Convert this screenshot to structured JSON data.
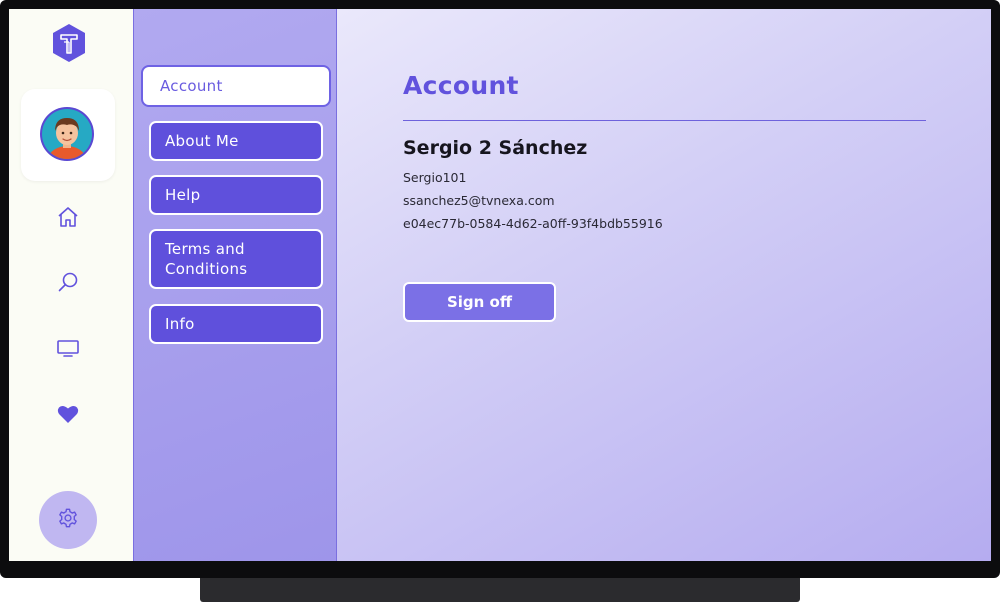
{
  "menu": {
    "items": [
      {
        "label": "Account",
        "active": true
      },
      {
        "label": "About Me"
      },
      {
        "label": "Help"
      },
      {
        "label": "Terms and Conditions"
      },
      {
        "label": "Info"
      }
    ]
  },
  "account": {
    "title": "Account",
    "name": "Sergio 2 Sánchez",
    "username": "Sergio101",
    "email": "ssanchez5@tvnexa.com",
    "user_id": "e04ec77b-0584-4d62-a0ff-93f4bdb55916",
    "signoff_label": "Sign off"
  },
  "rail": {
    "icons": [
      "logo-icon",
      "avatar",
      "home-icon",
      "search-icon",
      "tv-icon",
      "heart-icon",
      "gear-icon"
    ]
  },
  "colors": {
    "accent": "#6152dd",
    "menu_item": "#5f50dc",
    "signoff": "#7b70e6",
    "rail_bg": "#fbfcf5"
  }
}
